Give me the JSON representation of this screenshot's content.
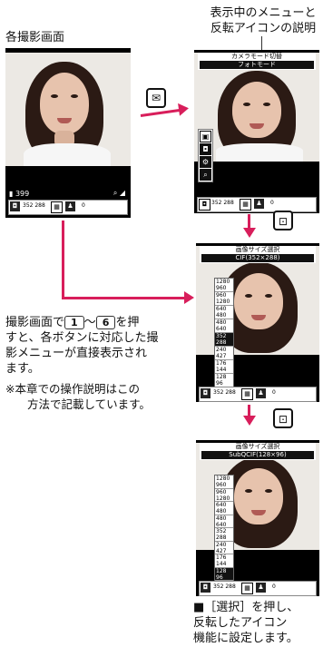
{
  "labels": {
    "each_screen": "各撮影画面",
    "menu_caption_line1": "表示中のメニューと",
    "menu_caption_line2": "反転アイコンの説明"
  },
  "screen1": {
    "count": "399"
  },
  "screen2": {
    "header_title": "カメラモード切替",
    "header_sub": "フォトモード"
  },
  "screen3": {
    "header_title": "画像サイズ選択",
    "header_sub": "CIF(352×288)"
  },
  "screen4": {
    "header_title": "画像サイズ選択",
    "header_sub": "SubQCIF(128×96)"
  },
  "statusbar": {
    "size_text": "352 288",
    "count_text": "0"
  },
  "size_menu": [
    "1280 960",
    "960 1280",
    "640 480",
    "480 640",
    "352 288",
    "240 427",
    "176 144",
    "128 96"
  ],
  "keys": {
    "mail_icon": "✉",
    "key_a": "⊡",
    "key_b": "⊡"
  },
  "instruction": {
    "line1_a": "撮影画面で",
    "key1": "1",
    "tilde": "～",
    "key6": "6",
    "line1_b": "を押",
    "line2": "すと、各ボタンに対応した撮",
    "line3": "影メニューが直接表示され",
    "line4": "ます。"
  },
  "note": {
    "line1": "※本章での操作説明はこの",
    "line2": "方法で記載しています。"
  },
  "select_caption": {
    "line1": "■［選択］を押し、",
    "line2": "反転したアイコン",
    "line3": "機能に設定します。"
  },
  "colors": {
    "arrow": "#d81e5b"
  }
}
